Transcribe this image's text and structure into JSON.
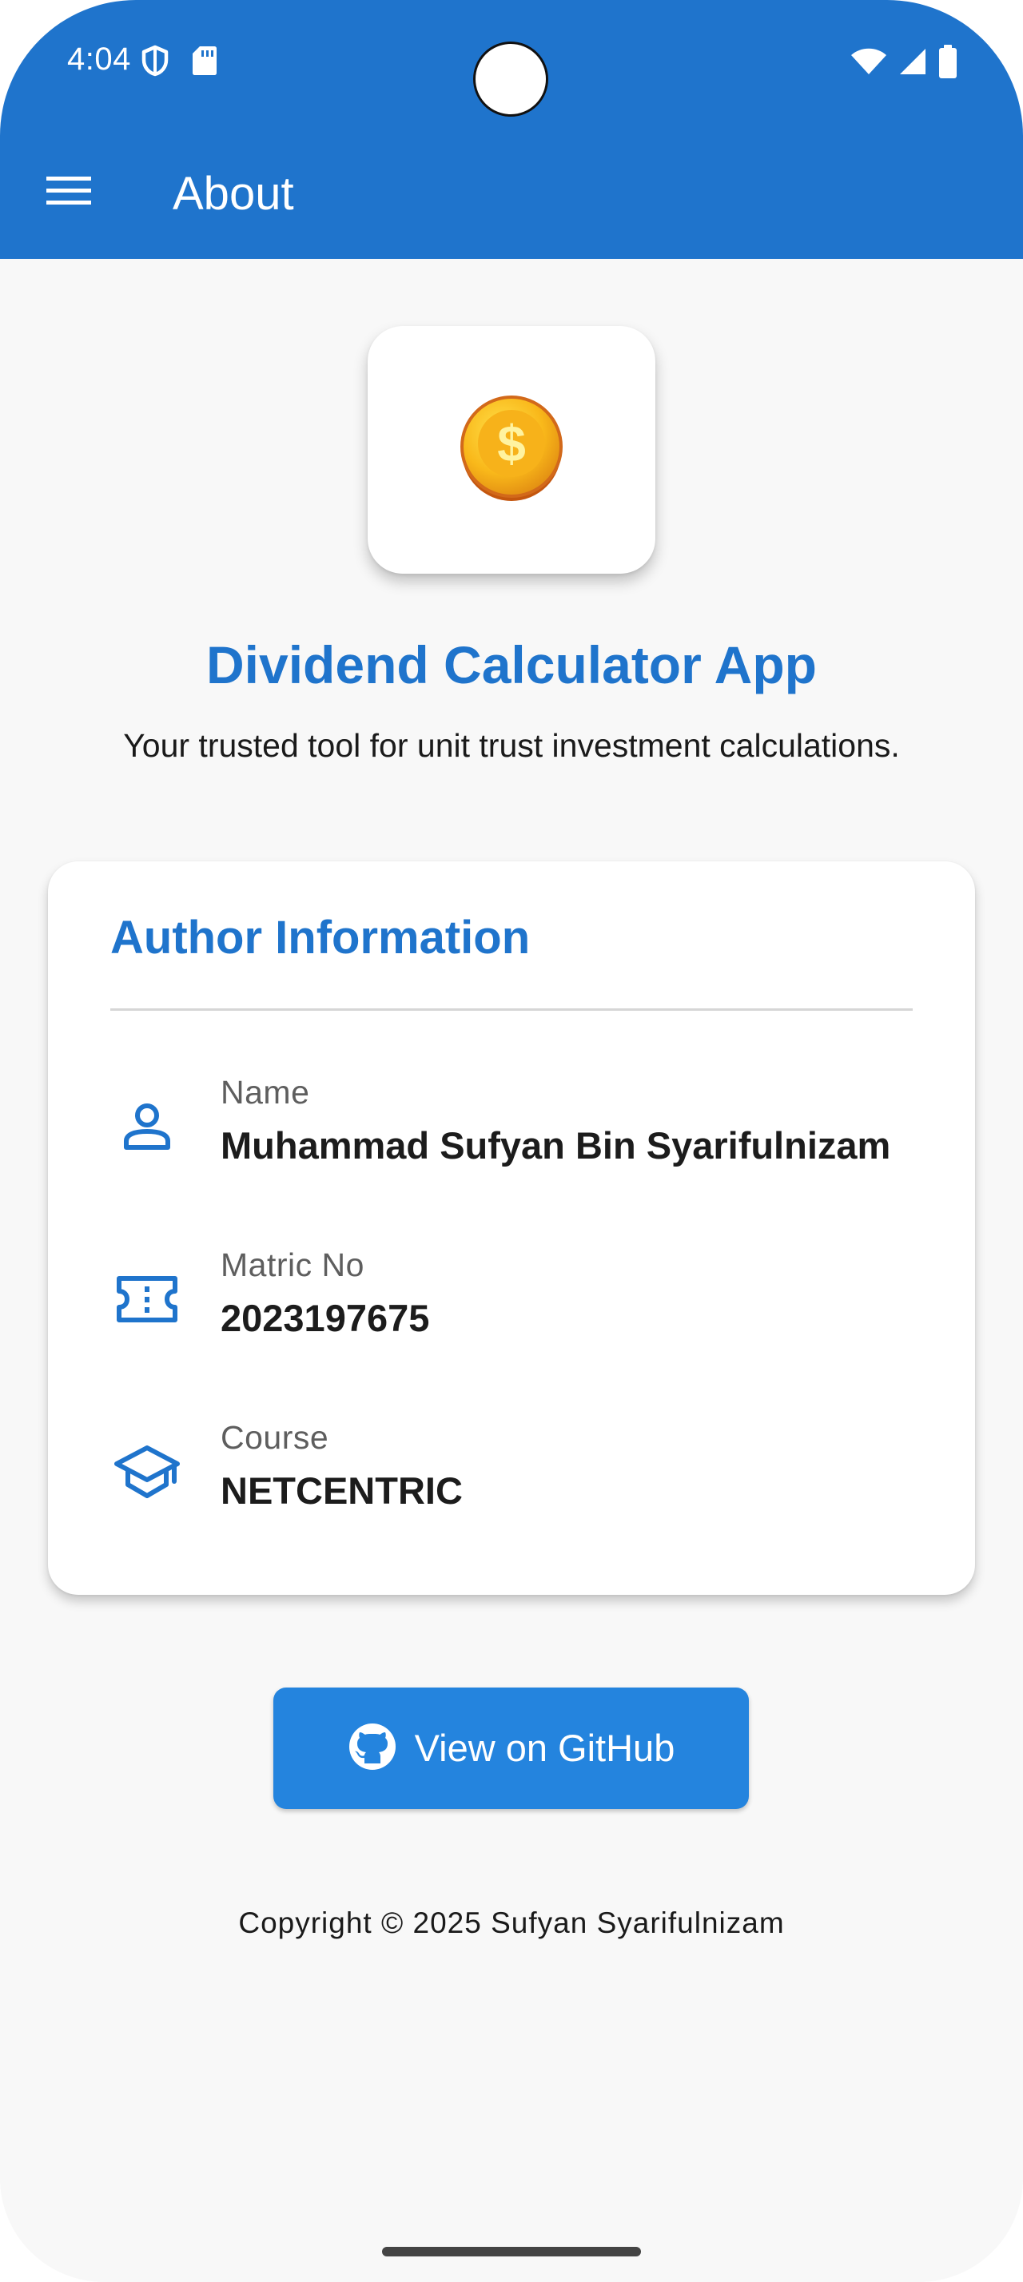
{
  "status_bar": {
    "time": "4:04",
    "left_icons": [
      "shield-icon",
      "sd-card-icon"
    ],
    "right_icons": [
      "wifi-icon",
      "cell-signal-icon",
      "battery-icon"
    ]
  },
  "app_bar": {
    "title": "About",
    "menu_icon": "menu-icon",
    "color": "#1f74cc"
  },
  "header": {
    "logo_icon": "dollar-coin-icon",
    "app_name": "Dividend Calculator App",
    "tagline": "Your trusted tool for unit trust investment calculations."
  },
  "author_card": {
    "heading": "Author Information",
    "rows": [
      {
        "icon": "person-icon",
        "label": "Name",
        "value": "Muhammad Sufyan Bin Syarifulnizam"
      },
      {
        "icon": "ticket-icon",
        "label": "Matric No",
        "value": "2023197675"
      },
      {
        "icon": "graduation-cap-icon",
        "label": "Course",
        "value": "NETCENTRIC"
      }
    ]
  },
  "github_button": {
    "label": "View on GitHub",
    "icon": "github-icon",
    "color": "#2484de"
  },
  "footer": {
    "copyright": "Copyright © 2025 Sufyan Syarifulnizam"
  }
}
